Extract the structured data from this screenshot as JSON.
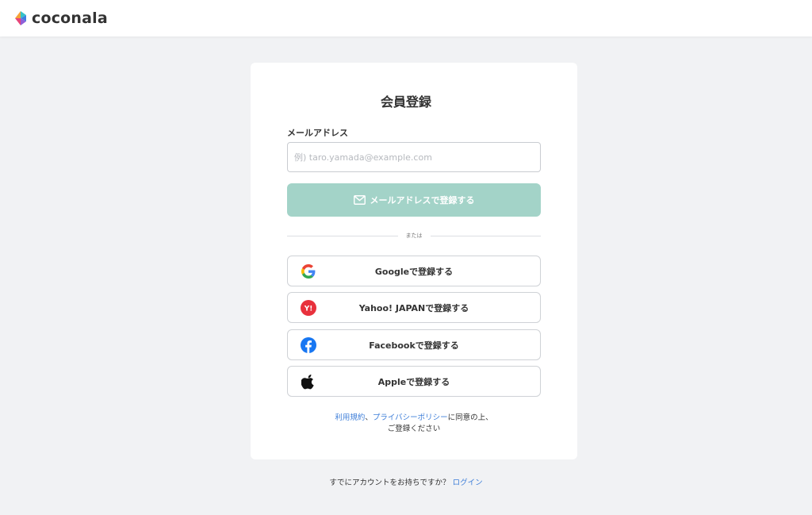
{
  "header": {
    "logo_text": "coconala"
  },
  "form": {
    "title": "会員登録",
    "email_label": "メールアドレス",
    "email_placeholder": "例) taro.yamada@example.com",
    "email_value": "",
    "email_button_label": "メールアドレスで登録する",
    "divider_text": "または"
  },
  "sso_buttons": [
    {
      "label": "Googleで登録する",
      "icon": "google-icon"
    },
    {
      "label": "Yahoo! JAPANで登録する",
      "icon": "yahoo-japan-icon"
    },
    {
      "label": "Facebookで登録する",
      "icon": "facebook-icon"
    },
    {
      "label": "Appleで登録する",
      "icon": "apple-icon"
    }
  ],
  "terms": {
    "terms_link": "利用規約",
    "separator": "、",
    "privacy_link": "プライバシーポリシー",
    "suffix_line1": "に同意の上、",
    "line2": "ご登録ください"
  },
  "footer": {
    "prompt": "すでにアカウントをお持ちですか？",
    "login_link": "ログイン"
  },
  "colors": {
    "accent_disabled": "#a3d3c8",
    "link": "#3f7fd9",
    "background": "#f1f2f4"
  }
}
